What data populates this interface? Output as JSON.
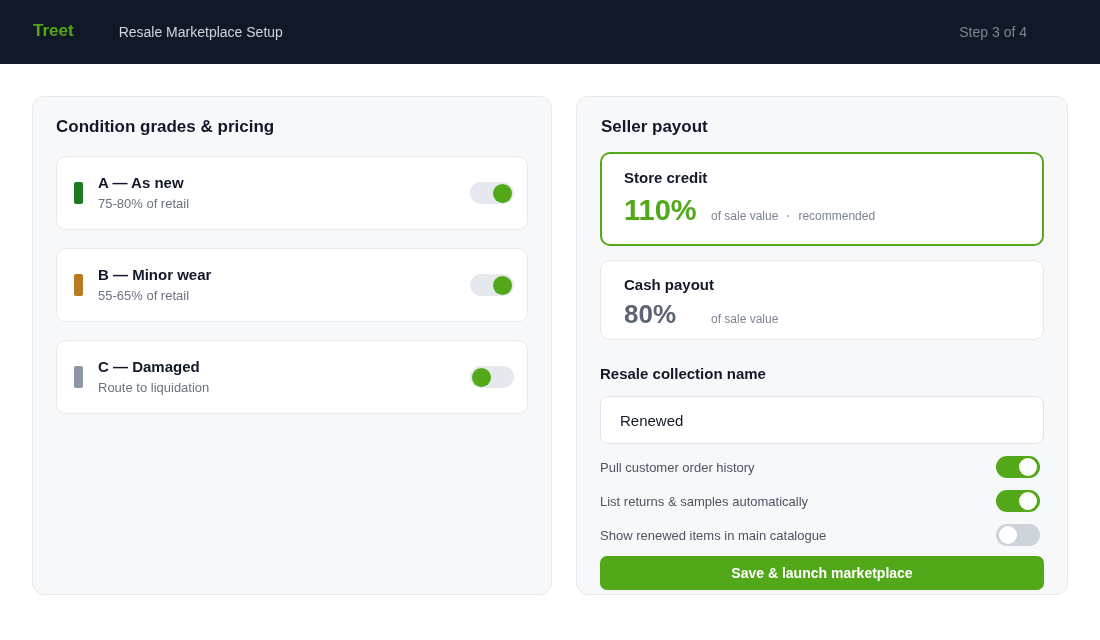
{
  "header": {
    "logo": "Treet",
    "title": "Resale Marketplace Setup",
    "step": "Step 3 of 4"
  },
  "grades_panel": {
    "title": "Condition grades & pricing",
    "grades": [
      {
        "name": "A — As new",
        "detail": "75-80% of retail",
        "color": "#1d7a21",
        "on": true
      },
      {
        "name": "B — Minor wear",
        "detail": "55-65% of retail",
        "color": "#b97a1f",
        "on": true
      },
      {
        "name": "C — Damaged",
        "detail": "Route to liquidation",
        "color": "#8b97a4",
        "on": false
      }
    ]
  },
  "payout_panel": {
    "title": "Seller payout",
    "options": [
      {
        "label": "Store credit",
        "value": "110%",
        "selected": true,
        "notes": [
          {
            "kind": "text",
            "text": "of sale value"
          },
          {
            "kind": "separator",
            "text": "·"
          },
          {
            "kind": "text",
            "text": "recommended"
          }
        ]
      },
      {
        "label": "Cash payout",
        "value": "80%",
        "selected": false,
        "notes": [
          {
            "kind": "text",
            "text": "of sale value"
          }
        ]
      }
    ],
    "collection_name": {
      "label": "Resale collection name",
      "value": "Renewed"
    },
    "settings": [
      {
        "label": "Pull customer order history",
        "on": true
      },
      {
        "label": "List returns & samples automatically",
        "on": true
      },
      {
        "label": "Show renewed items in main catalogue",
        "on": false
      }
    ],
    "save_button": "Save & launch marketplace"
  }
}
